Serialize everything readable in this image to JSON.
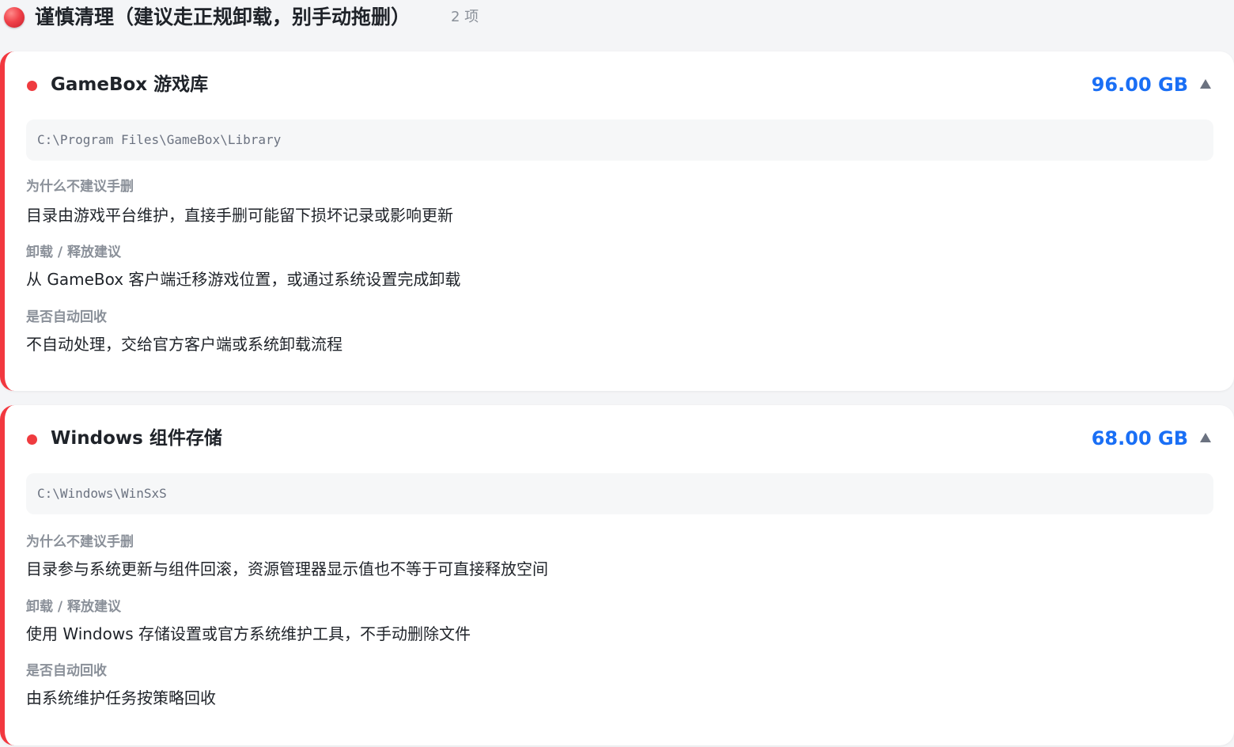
{
  "section": {
    "title": "谨慎清理（建议走正规卸载，别手动拖删）",
    "count": "2 项"
  },
  "labels": {
    "why": "为什么不建议手删",
    "uninstall": "卸载 / 释放建议",
    "auto": "是否自动回收"
  },
  "items": [
    {
      "title": "GameBox 游戏库",
      "size": "96.00 GB",
      "path": "C:\\Program Files\\GameBox\\Library",
      "why": "目录由游戏平台维护，直接手删可能留下损坏记录或影响更新",
      "uninstall": "从 GameBox 客户端迁移游戏位置，或通过系统设置完成卸载",
      "auto": "不自动处理，交给官方客户端或系统卸载流程"
    },
    {
      "title": "Windows 组件存储",
      "size": "68.00 GB",
      "path": "C:\\Windows\\WinSxS",
      "why": "目录参与系统更新与组件回滚，资源管理器显示值也不等于可直接释放空间",
      "uninstall": "使用 Windows 存储设置或官方系统维护工具，不手动删除文件",
      "auto": "由系统维护任务按策略回收"
    }
  ],
  "colors": {
    "accent": "#f2383f",
    "size": "#1a6ff5"
  }
}
